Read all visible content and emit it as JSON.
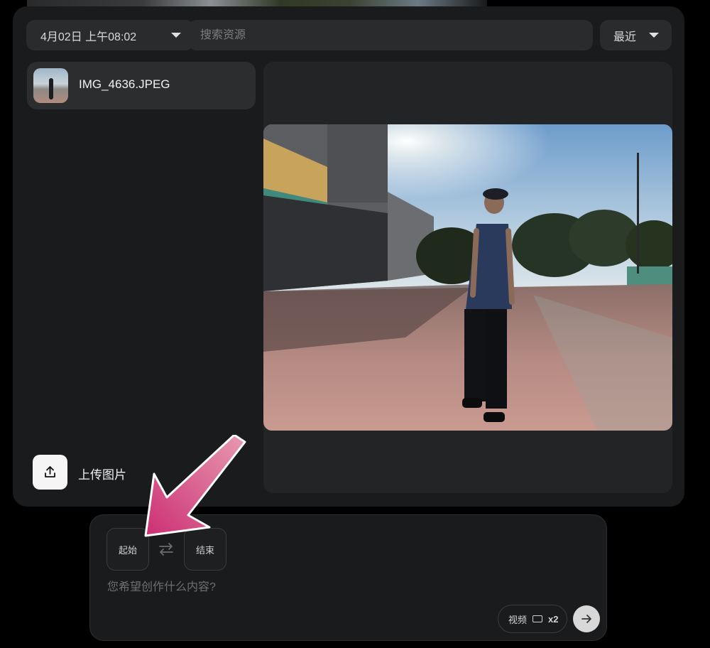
{
  "filters": {
    "date_label": "4月02日 上午08:02",
    "search_placeholder": "搜索资源",
    "sort_label": "最近"
  },
  "files": [
    {
      "name": "IMG_4636.JPEG"
    }
  ],
  "upload": {
    "label": "上传图片"
  },
  "composer": {
    "start_label": "起始",
    "end_label": "结束",
    "prompt_placeholder": "您希望创作什么内容?",
    "mode_label": "视频",
    "count_label": "x2"
  },
  "colors": {
    "panel_bg": "#1a1b1c",
    "control_bg": "#2a2b2d",
    "annotation_arrow": "#d23b7a"
  }
}
